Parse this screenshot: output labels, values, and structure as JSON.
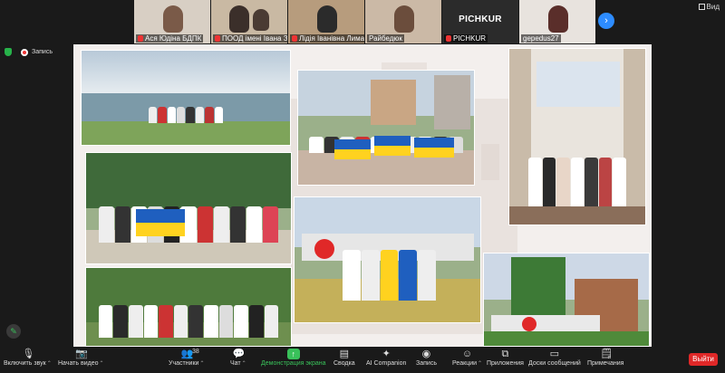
{
  "participants": [
    {
      "name": "Ася Юдіна БДПК",
      "bg": "#d8cfc4",
      "face": "#7a5a48",
      "muted": true
    },
    {
      "name": "ПООД імені Івана Зязюна",
      "bg": "#c9b9a3",
      "face": "#3b2f2a",
      "muted": true
    },
    {
      "name": "Лідія Іванівна Лимаренко",
      "bg": "#b79c7d",
      "face": "#2b2b2b",
      "muted": true
    },
    {
      "name": "Райбедюк",
      "bg": "#cbb9a6",
      "face": "#6b4d3c",
      "muted": false
    },
    {
      "name": "PICHKUR",
      "big": "PICHKUR",
      "muted": true
    },
    {
      "name": "gepedus27",
      "bg": "#e8e3de",
      "face": "#5a2e2a",
      "muted": false
    }
  ],
  "view_label": "Вид",
  "recording_label": "Запись",
  "toolbar": {
    "audio": "Включить звук",
    "video": "Начать видео",
    "participants": "Участники",
    "participants_count": "38",
    "chat": "Чат",
    "share": "Демонстрация экрана",
    "notes": "Сводка",
    "ai": "AI Companion",
    "record": "Запись",
    "reactions": "Реакции",
    "apps": "Приложения",
    "whiteboard": "Доски сообщений",
    "notes2": "Примечания",
    "leave": "Выйти"
  },
  "accent_colors": {
    "blue": "#2d8cff",
    "green": "#39c15a",
    "red": "#e02828"
  }
}
